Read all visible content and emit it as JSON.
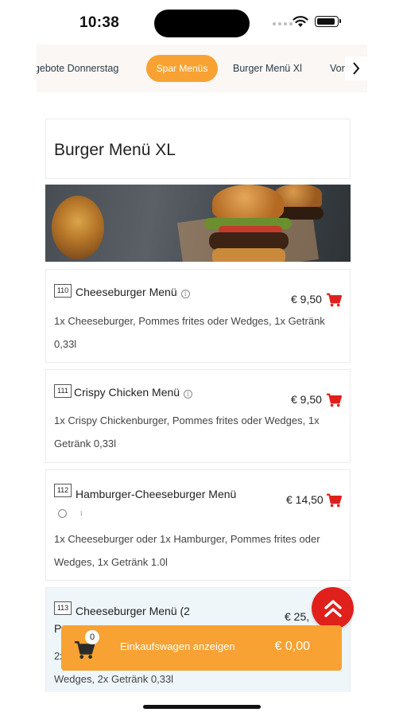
{
  "status_bar": {
    "time": "10:38"
  },
  "categories": {
    "items": [
      "ngebote Donnerstag",
      "Spar Menüs",
      "Burger Menü Xl",
      "Vors"
    ],
    "active_index": 1,
    "next_icon": "chevron-right-icon"
  },
  "section": {
    "title": "Burger Menü XL"
  },
  "menu": {
    "items": [
      {
        "number": "110",
        "name": "Cheeseburger Menü",
        "price": "€ 9,50",
        "description": "1x Cheeseburger, Pommes frites oder Wedges, 1x Getränk 0,33l"
      },
      {
        "number": "111",
        "name": "Crispy Chicken Menü",
        "price": "€ 9,50",
        "description": "1x Crispy Chickenburger, Pommes frites oder Wedges, 1x Getränk 0,33l"
      },
      {
        "number": "112",
        "name": "Hamburger-Cheeseburger Menü",
        "price": "€ 14,50",
        "description": "1x Cheeseburger oder 1x Hamburger, Pommes frites oder Wedges, 1x Getränk 1.0l"
      },
      {
        "number": "113",
        "name": "Cheeseburger Menü (2",
        "name_line2": "P",
        "price": "€ 25,",
        "description_line1": "2x",
        "description_line2": "Wedges, 2x Getränk 0,33l"
      }
    ]
  },
  "cart": {
    "count": "0",
    "label": "Einkaufswagen anzeigen",
    "total": "€ 0,00"
  },
  "colors": {
    "accent": "#f7a232",
    "cart_red": "#e0201b",
    "highlight_bg": "#eef6f9"
  }
}
